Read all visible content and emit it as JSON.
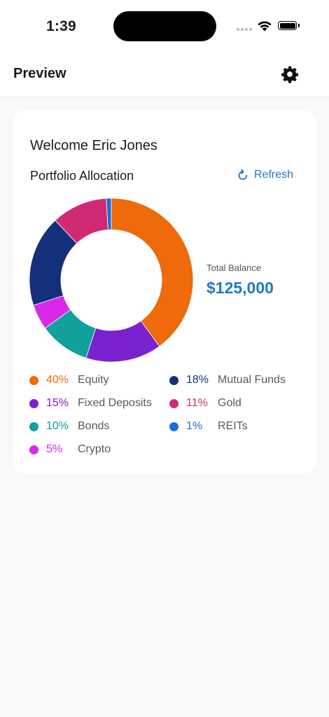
{
  "status_bar": {
    "time": "1:39"
  },
  "header": {
    "title": "Preview"
  },
  "card": {
    "welcome": "Welcome Eric Jones",
    "section_title": "Portfolio Allocation",
    "refresh_label": "Refresh",
    "balance_label": "Total Balance",
    "balance_value": "$125,000"
  },
  "chart_data": {
    "type": "pie",
    "slices": [
      {
        "label": "Equity",
        "value": 40,
        "percent_text": "40%",
        "color": "#ee6a0a"
      },
      {
        "label": "Fixed Deposits",
        "value": 15,
        "percent_text": "15%",
        "color": "#7a22d0"
      },
      {
        "label": "Bonds",
        "value": 10,
        "percent_text": "10%",
        "color": "#11a09b"
      },
      {
        "label": "Crypto",
        "value": 5,
        "percent_text": "5%",
        "color": "#d928e8"
      },
      {
        "label": "Mutual Funds",
        "value": 18,
        "percent_text": "18%",
        "color": "#14307a"
      },
      {
        "label": "Gold",
        "value": 11,
        "percent_text": "11%",
        "color": "#d12a74"
      },
      {
        "label": "REITs",
        "value": 1,
        "percent_text": "1%",
        "color": "#1e6ed8"
      }
    ]
  }
}
